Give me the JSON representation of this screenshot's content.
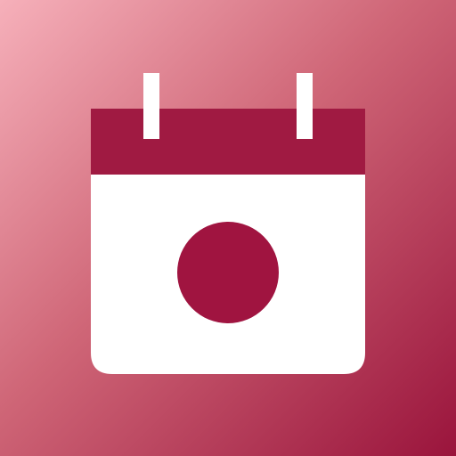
{
  "icon": {
    "name": "japan-calendar-icon",
    "colors": {
      "background_light": "#f6b0ba",
      "background_mid": "#cf6677",
      "background_dark": "#9a143c",
      "calendar_header": "#a01a42",
      "calendar_body": "#ffffff",
      "rings": "#ffffff",
      "sun_disc": "#a01440"
    }
  }
}
